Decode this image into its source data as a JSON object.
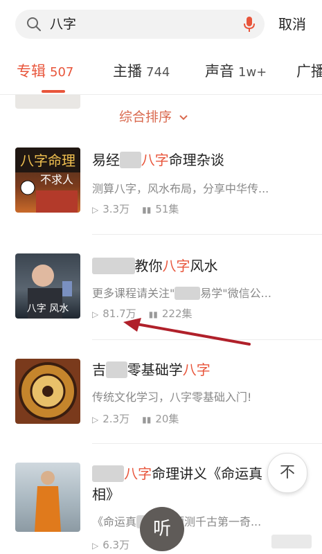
{
  "search": {
    "query": "八字",
    "cancel_label": "取消"
  },
  "tabs": [
    {
      "label": "专辑",
      "count": "507",
      "active": true
    },
    {
      "label": "主播",
      "count": "744",
      "active": false
    },
    {
      "label": "声音",
      "count": "1w+",
      "active": false
    },
    {
      "label": "广播",
      "count": "",
      "active": false
    }
  ],
  "sort": {
    "label": "综合排序"
  },
  "albums": [
    {
      "title_prefix": "易经",
      "title_blur": "██",
      "title_hl": "八字",
      "title_suffix": "命理杂谈",
      "title_line2": "",
      "desc": "测算八字，风水布局，分享中华传...",
      "plays": "3.3万",
      "tracks": "51集",
      "cover_text": "八字命理",
      "cover_sub": "不求人"
    },
    {
      "title_prefix": "",
      "title_blur": "████",
      "title_hl": "八字",
      "title_suffix": "风水",
      "title_pre_hl": "教你",
      "title_line2": "",
      "desc": "更多课程请关注\"",
      "desc_blur": "███",
      "desc_suffix": "易学\"微信公...",
      "plays": "81.7万",
      "tracks": "222集",
      "cover_text": "八字 风水"
    },
    {
      "title_prefix": "吉",
      "title_blur": "██",
      "title_hl": "八字",
      "title_pre_hl": "零基础学",
      "title_suffix": "",
      "title_line2": "",
      "desc": "传统文化学习，八字零基础入门!",
      "plays": "2.3万",
      "tracks": "20集"
    },
    {
      "title_prefix": "",
      "title_blur": "███",
      "title_hl": "八字",
      "title_suffix": "命理讲义《命运真",
      "title_line2": "相》",
      "desc": "《命运真",
      "desc_blur": "███",
      "desc_suffix": "字预测千古第一奇...",
      "plays": "6.3万",
      "tracks": ""
    }
  ],
  "float_button": "不",
  "listen_button": "听",
  "colors": {
    "accent": "#e8553b",
    "sort": "#d9694e",
    "arrow": "#b0202a"
  }
}
